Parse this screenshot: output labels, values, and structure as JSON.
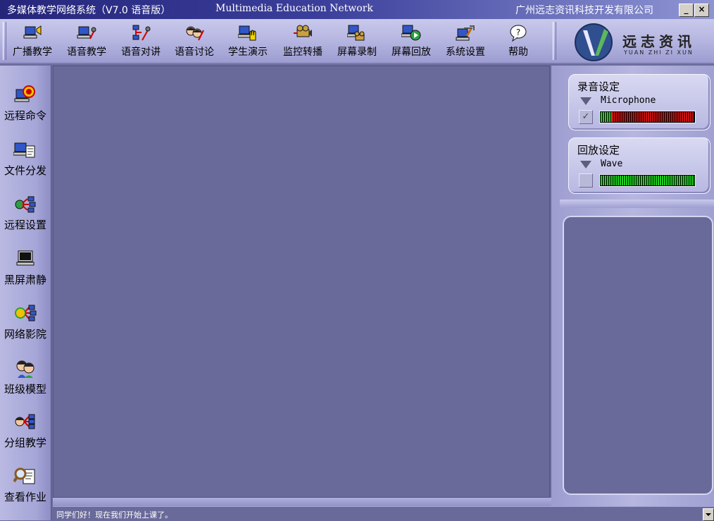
{
  "window": {
    "title_cn": "多媒体教学网络系统（V7.0 语音版）",
    "title_en": "Multimedia Education Network",
    "company": "广州远志资讯科技开发有限公司",
    "minimize_label": "_",
    "close_label": "×"
  },
  "toolbar": {
    "items": [
      {
        "label": "广播教学",
        "icon": "broadcast-icon"
      },
      {
        "label": "语音教学",
        "icon": "voice-teach-icon"
      },
      {
        "label": "语音对讲",
        "icon": "intercom-icon"
      },
      {
        "label": "语音讨论",
        "icon": "discussion-icon"
      },
      {
        "label": "学生演示",
        "icon": "student-demo-icon"
      },
      {
        "label": "监控转播",
        "icon": "monitor-camera-icon"
      },
      {
        "label": "屏幕录制",
        "icon": "screen-record-icon"
      },
      {
        "label": "屏幕回放",
        "icon": "screen-playback-icon"
      },
      {
        "label": "系统设置",
        "icon": "system-settings-icon"
      },
      {
        "label": "帮助",
        "icon": "help-icon"
      }
    ]
  },
  "logo": {
    "text": "远志资讯",
    "sub": "YUAN ZHI ZI XUN"
  },
  "sidebar": {
    "items": [
      {
        "label": "远程命令",
        "icon": "remote-command-icon"
      },
      {
        "label": "文件分发",
        "icon": "file-distribute-icon"
      },
      {
        "label": "远程设置",
        "icon": "remote-settings-icon"
      },
      {
        "label": "黑屏肃静",
        "icon": "black-screen-icon"
      },
      {
        "label": "网络影院",
        "icon": "network-cinema-icon"
      },
      {
        "label": "班级模型",
        "icon": "class-model-icon"
      },
      {
        "label": "分组教学",
        "icon": "group-teach-icon"
      },
      {
        "label": "查看作业",
        "icon": "view-homework-icon"
      }
    ]
  },
  "record": {
    "title": "录音设定",
    "device": "Microphone",
    "checked": true,
    "level": 0.12,
    "colors": {
      "low": "#1fd21f",
      "high": "#c81010"
    }
  },
  "playback": {
    "title": "回放设定",
    "device": "Wave",
    "checked": false,
    "level": 1.0,
    "colors": {
      "low": "#1fd21f",
      "high": "#1fd21f"
    }
  },
  "status": {
    "message": "同学们好！现在我们开始上课了。"
  }
}
